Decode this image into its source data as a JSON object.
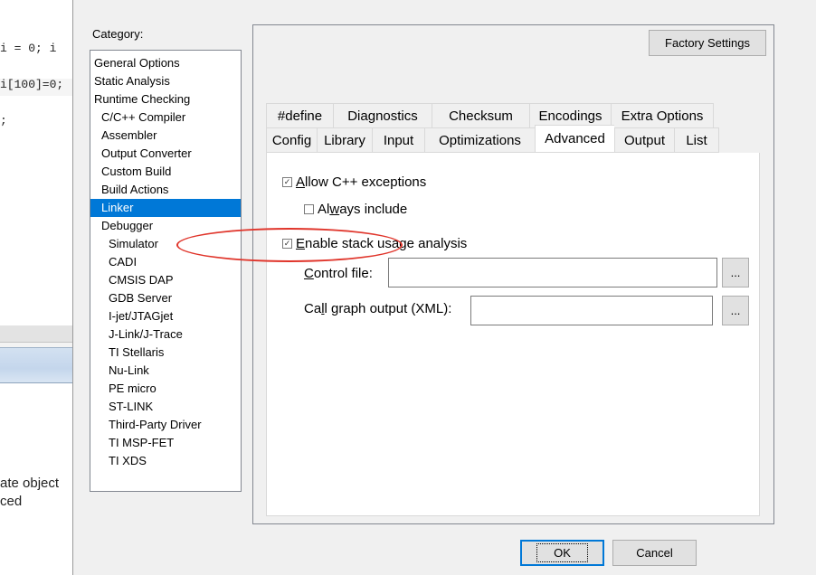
{
  "editor": {
    "code_lines": [
      "i = 0; i",
      "i[100]=0;",
      ";"
    ],
    "output_lines": [
      "ate object",
      "ced"
    ]
  },
  "dialog": {
    "category_label": "Category:",
    "categories": [
      {
        "label": "General Options",
        "level": 0,
        "selected": false
      },
      {
        "label": "Static Analysis",
        "level": 0,
        "selected": false
      },
      {
        "label": "Runtime Checking",
        "level": 0,
        "selected": false
      },
      {
        "label": "C/C++ Compiler",
        "level": 1,
        "selected": false
      },
      {
        "label": "Assembler",
        "level": 1,
        "selected": false
      },
      {
        "label": "Output Converter",
        "level": 1,
        "selected": false
      },
      {
        "label": "Custom Build",
        "level": 1,
        "selected": false
      },
      {
        "label": "Build Actions",
        "level": 1,
        "selected": false
      },
      {
        "label": "Linker",
        "level": 1,
        "selected": true
      },
      {
        "label": "Debugger",
        "level": 1,
        "selected": false
      },
      {
        "label": "Simulator",
        "level": 2,
        "selected": false
      },
      {
        "label": "CADI",
        "level": 2,
        "selected": false
      },
      {
        "label": "CMSIS DAP",
        "level": 2,
        "selected": false
      },
      {
        "label": "GDB Server",
        "level": 2,
        "selected": false
      },
      {
        "label": "I-jet/JTAGjet",
        "level": 2,
        "selected": false
      },
      {
        "label": "J-Link/J-Trace",
        "level": 2,
        "selected": false
      },
      {
        "label": "TI Stellaris",
        "level": 2,
        "selected": false
      },
      {
        "label": "Nu-Link",
        "level": 2,
        "selected": false
      },
      {
        "label": "PE micro",
        "level": 2,
        "selected": false
      },
      {
        "label": "ST-LINK",
        "level": 2,
        "selected": false
      },
      {
        "label": "Third-Party Driver",
        "level": 2,
        "selected": false
      },
      {
        "label": "TI MSP-FET",
        "level": 2,
        "selected": false
      },
      {
        "label": "TI XDS",
        "level": 2,
        "selected": false
      }
    ],
    "factory_settings": "Factory Settings",
    "tabs_row1": [
      {
        "label": "#define",
        "width": 74
      },
      {
        "label": "Diagnostics",
        "width": 109
      },
      {
        "label": "Checksum",
        "width": 108
      },
      {
        "label": "Encodings",
        "width": 90
      },
      {
        "label": "Extra Options",
        "width": 114
      }
    ],
    "tabs_row2": [
      {
        "label": "Config",
        "width": 56
      },
      {
        "label": "Library",
        "width": 61
      },
      {
        "label": "Input",
        "width": 58
      },
      {
        "label": "Optimizations",
        "width": 122
      },
      {
        "label": "Advanced",
        "width": 88,
        "active": true
      },
      {
        "label": "Output",
        "width": 66
      },
      {
        "label": "List",
        "width": 50
      }
    ],
    "options": {
      "allow_cpp_exceptions": {
        "prefix": "",
        "accel": "A",
        "rest": "llow C++ exceptions",
        "checked": true
      },
      "always_include": {
        "prefix": "Al",
        "accel": "w",
        "rest": "ays include",
        "checked": false
      },
      "enable_stack_usage": {
        "prefix": "",
        "accel": "E",
        "rest": "nable stack usage analysis",
        "checked": true
      }
    },
    "control_file": {
      "prefix": "",
      "accel": "C",
      "rest": "ontrol file:",
      "value": ""
    },
    "call_graph": {
      "prefix": "Ca",
      "accel": "l",
      "rest": "l graph output (XML):",
      "value": ""
    },
    "browse_label": "...",
    "ok_label": "OK",
    "cancel_label": "Cancel"
  }
}
